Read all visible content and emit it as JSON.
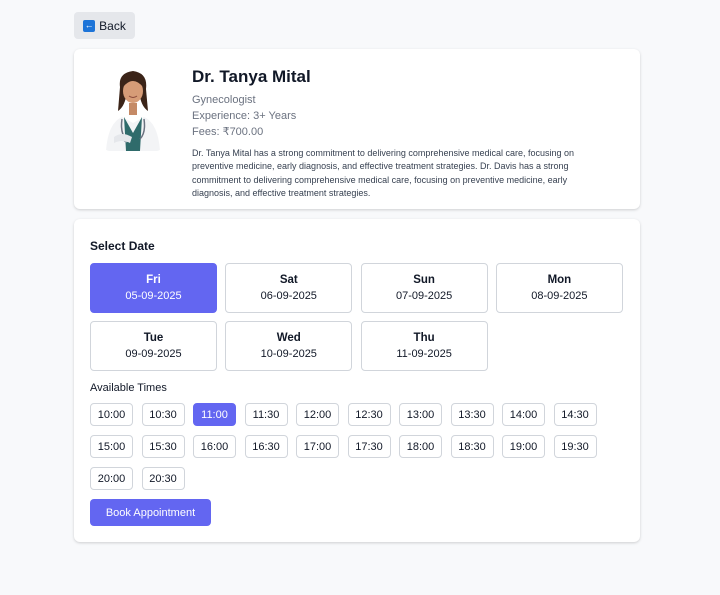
{
  "back_button": {
    "label": "Back",
    "icon": "arrow-left-icon"
  },
  "doctor": {
    "name": "Dr. Tanya Mital",
    "specialty": "Gynecologist",
    "experience": "Experience: 3+ Years",
    "fees": "Fees: ₹700.00",
    "about": "Dr. Tanya Mital has a strong commitment to delivering comprehensive medical care, focusing on preventive medicine, early diagnosis, and effective treatment strategies. Dr. Davis has a strong commitment to delivering comprehensive medical care, focusing on preventive medicine, early diagnosis, and effective treatment strategies."
  },
  "booking": {
    "select_date_label": "Select Date",
    "dates": [
      {
        "day": "Fri",
        "date": "05-09-2025",
        "selected": true
      },
      {
        "day": "Sat",
        "date": "06-09-2025",
        "selected": false
      },
      {
        "day": "Sun",
        "date": "07-09-2025",
        "selected": false
      },
      {
        "day": "Mon",
        "date": "08-09-2025",
        "selected": false
      },
      {
        "day": "Tue",
        "date": "09-09-2025",
        "selected": false
      },
      {
        "day": "Wed",
        "date": "10-09-2025",
        "selected": false
      },
      {
        "day": "Thu",
        "date": "11-09-2025",
        "selected": false
      }
    ],
    "available_times_label": "Available Times",
    "times": [
      "10:00",
      "10:30",
      "11:00",
      "11:30",
      "12:00",
      "12:30",
      "13:00",
      "13:30",
      "14:00",
      "14:30",
      "15:00",
      "15:30",
      "16:00",
      "16:30",
      "17:00",
      "17:30",
      "18:00",
      "18:30",
      "19:00",
      "19:30",
      "20:00",
      "20:30"
    ],
    "selected_time": "11:00",
    "book_button_label": "Book Appointment"
  },
  "colors": {
    "accent": "#6366f1",
    "page_bg": "#f8f9fb",
    "back_icon": "#1d74d8"
  }
}
